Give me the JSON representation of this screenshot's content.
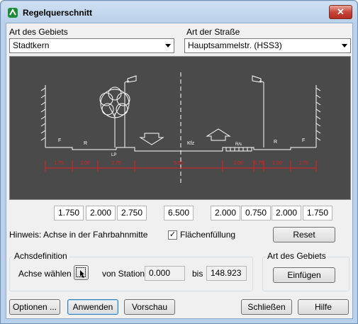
{
  "window": {
    "title": "Regelquerschnitt",
    "close_glyph": "✕"
  },
  "gebiet": {
    "label": "Art des Gebiets",
    "value": "Stadtkern"
  },
  "strasse": {
    "label": "Art der Straße",
    "value": "Hauptsammelstr. (HSS3)"
  },
  "diagram": {
    "dimensions": [
      "1.75",
      "2.00",
      "2.75",
      "6.50",
      "2.00",
      "0.75",
      "2.00",
      "1.75"
    ],
    "lane_label": "Kfz",
    "left_walk_label": "F",
    "left_bike_label": "R",
    "right_bike_label": "R",
    "right_walk_label": "F",
    "tree_label": "LP",
    "stop_label": "R/s",
    "colors": {
      "background": "#4a4a4a",
      "lines": "#ffffff",
      "dimensions": "#e02020"
    }
  },
  "widths": [
    "1.750",
    "2.000",
    "2.750",
    "6.500",
    "2.000",
    "0.750",
    "2.000",
    "1.750"
  ],
  "hint": "Hinweis: Achse in der Fahrbahnmitte",
  "flaechenfuellung": {
    "label": "Flächenfüllung",
    "checked": true,
    "mark": "✓"
  },
  "reset_label": "Reset",
  "achsdefinition": {
    "title": "Achsdefinition",
    "achse_label": "Achse wählen",
    "von_label": "von Station",
    "von_value": "0.000",
    "bis_label": "bis",
    "bis_value": "148.923"
  },
  "gebiet_group": {
    "title": "Art des Gebiets",
    "button": "Einfügen"
  },
  "footer": {
    "optionen": "Optionen ...",
    "anwenden": "Anwenden",
    "vorschau": "Vorschau",
    "schliessen": "Schließen",
    "hilfe": "Hilfe"
  }
}
